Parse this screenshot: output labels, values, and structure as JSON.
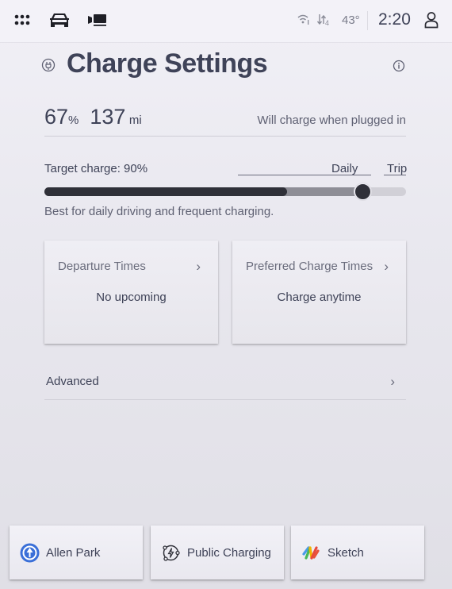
{
  "status_bar": {
    "icons": [
      "apps-grid-icon",
      "car-icon",
      "media-icon",
      "wifi-icon",
      "data-signal-icon",
      "user-icon"
    ],
    "temperature": "43°",
    "time": "2:20"
  },
  "header": {
    "title": "Charge Settings",
    "icon": "plug-icon",
    "info_icon": "info-icon"
  },
  "stats": {
    "charge_value": "67",
    "charge_unit": "%",
    "range_value": "137",
    "range_unit": "mi",
    "status": "Will charge when plugged in"
  },
  "target_charge": {
    "label": "Target charge: 90%",
    "mode_daily": "Daily",
    "mode_trip": "Trip",
    "current_charge_percent": 67,
    "target_percent": 88,
    "description": "Best for daily driving and frequent charging."
  },
  "cards": [
    {
      "title": "Departure Times",
      "value": "No upcoming",
      "chevron": "›"
    },
    {
      "title": "Preferred Charge Times",
      "value": "Charge anytime",
      "chevron": "›"
    }
  ],
  "advanced": {
    "label": "Advanced",
    "chevron": "›"
  },
  "dock": [
    {
      "label": "Allen Park",
      "icon": "navigation-icon",
      "color": "#3a6fd8"
    },
    {
      "label": "Public Charging",
      "icon": "public-charging-icon"
    },
    {
      "label": "Sketch",
      "icon": "sketch-icon"
    }
  ],
  "colors": {
    "text_primary": "#3e4257",
    "slider_current": "#2f3038",
    "slider_target": "#8e8e96",
    "slider_track": "#d1d0d7"
  }
}
